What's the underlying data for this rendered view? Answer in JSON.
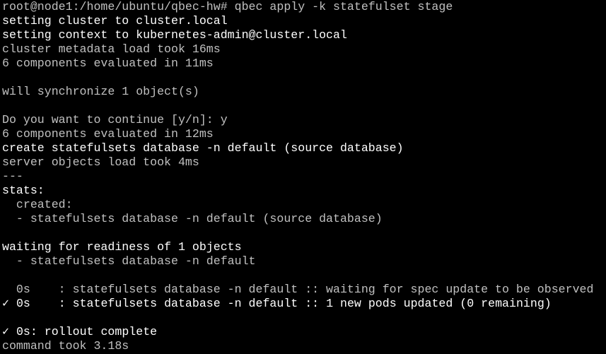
{
  "terminal": {
    "colors": {
      "background": "#000000",
      "text_dim": "#c0c0c0",
      "text_bright": "#ffffff"
    },
    "lines": [
      {
        "text": "root@node1:/home/ubuntu/qbec-hw# qbec apply -k statefulset stage",
        "style": "dim"
      },
      {
        "text": "setting cluster to cluster.local",
        "style": "bright"
      },
      {
        "text": "setting context to kubernetes-admin@cluster.local",
        "style": "bright"
      },
      {
        "text": "cluster metadata load took 16ms",
        "style": "dim"
      },
      {
        "text": "6 components evaluated in 11ms",
        "style": "dim"
      },
      {
        "text": "",
        "style": "dim"
      },
      {
        "text": "will synchronize 1 object(s)",
        "style": "dim"
      },
      {
        "text": "",
        "style": "dim"
      },
      {
        "text": "Do you want to continue [y/n]: y",
        "style": "dim"
      },
      {
        "text": "6 components evaluated in 12ms",
        "style": "dim"
      },
      {
        "text": "create statefulsets database -n default (source database)",
        "style": "bright"
      },
      {
        "text": "server objects load took 4ms",
        "style": "dim"
      },
      {
        "text": "---",
        "style": "dim"
      },
      {
        "text": "stats:",
        "style": "bright"
      },
      {
        "text": "  created:",
        "style": "dim"
      },
      {
        "text": "  - statefulsets database -n default (source database)",
        "style": "dim"
      },
      {
        "text": "",
        "style": "dim"
      },
      {
        "text": "waiting for readiness of 1 objects",
        "style": "bright"
      },
      {
        "text": "  - statefulsets database -n default",
        "style": "dim"
      },
      {
        "text": "",
        "style": "dim"
      },
      {
        "text": "  0s    : statefulsets database -n default :: waiting for spec update to be observed",
        "style": "dim"
      },
      {
        "text": "✓ 0s    : statefulsets database -n default :: 1 new pods updated (0 remaining)",
        "style": "bright"
      },
      {
        "text": "",
        "style": "dim"
      },
      {
        "text": "✓ 0s: rollout complete",
        "style": "bright"
      },
      {
        "text": "command took 3.18s",
        "style": "dim"
      }
    ]
  }
}
